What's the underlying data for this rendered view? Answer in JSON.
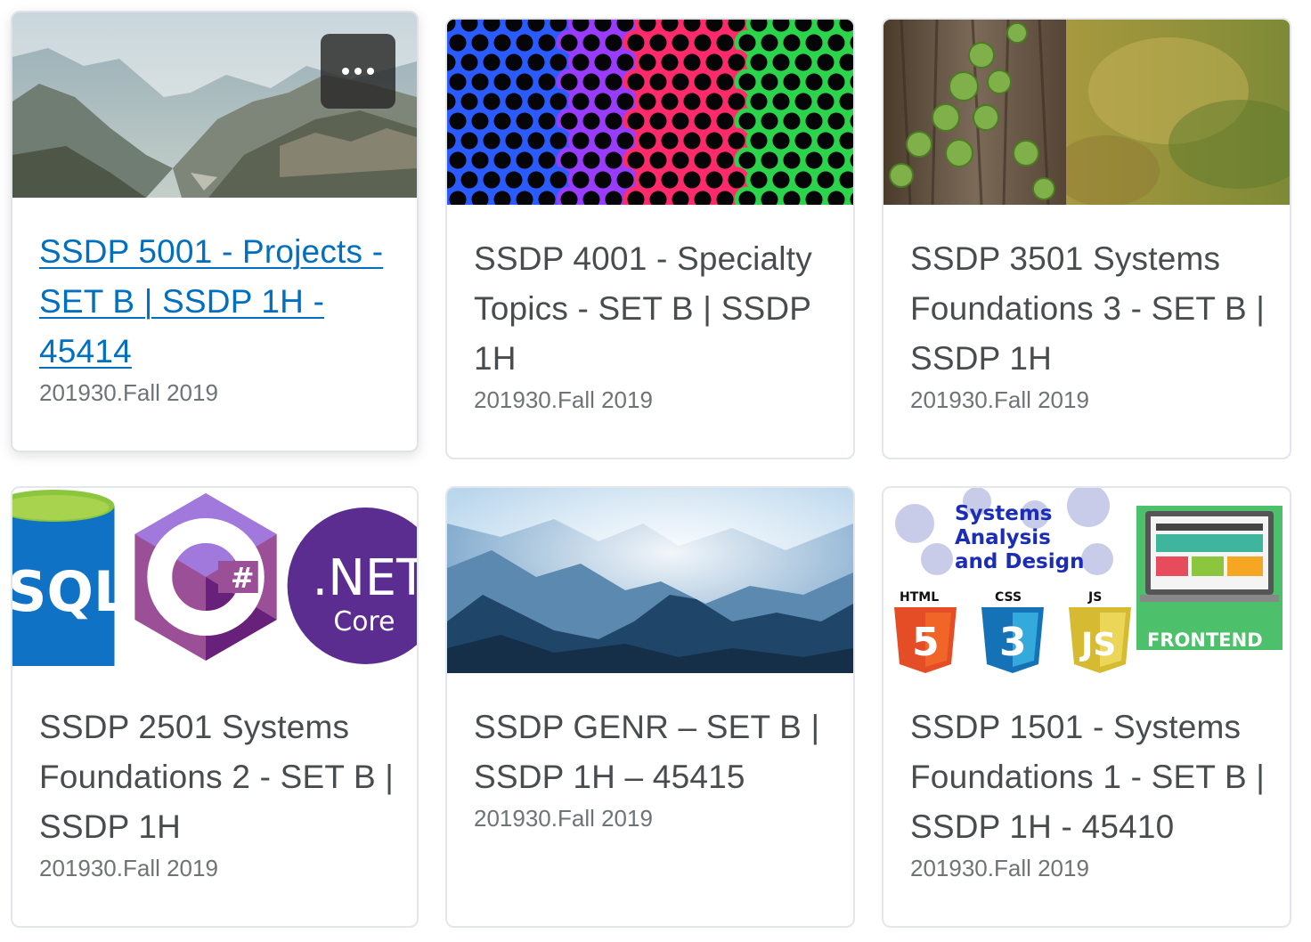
{
  "menu": {
    "more_label": "..."
  },
  "courses": [
    {
      "title": "SSDP 5001 - Projects - SET B | SSDP 1H - 45414",
      "term": "201930.Fall 2019",
      "linked": true
    },
    {
      "title": "SSDP 4001 - Specialty Topics - SET B | SSDP 1H",
      "term": "201930.Fall 2019"
    },
    {
      "title": "SSDP 3501 Systems Foundations 3 - SET B | SSDP 1H",
      "term": "201930.Fall 2019"
    },
    {
      "title": "SSDP 2501 Systems Foundations 2 - SET B | SSDP 1H",
      "term": "201930.Fall 2019",
      "image_text": [
        "SQL",
        "C",
        "#",
        ".NET",
        "Core"
      ]
    },
    {
      "title": "SSDP GENR – SET B | SSDP 1H – 45415",
      "term": "201930.Fall 2019"
    },
    {
      "title": "SSDP 1501 - Systems Foundations 1 - SET B | SSDP 1H - 45410",
      "term": "201930.Fall 2019",
      "image_text": [
        "Systems",
        "Analysis",
        "and Design",
        "HTML",
        "CSS",
        "JS",
        "FRONTEND",
        "5",
        "3"
      ]
    }
  ],
  "colors": {
    "link": "#006fbf",
    "title": "#494c4e",
    "subtitle": "#6e7376",
    "border": "#e3e6ea"
  }
}
